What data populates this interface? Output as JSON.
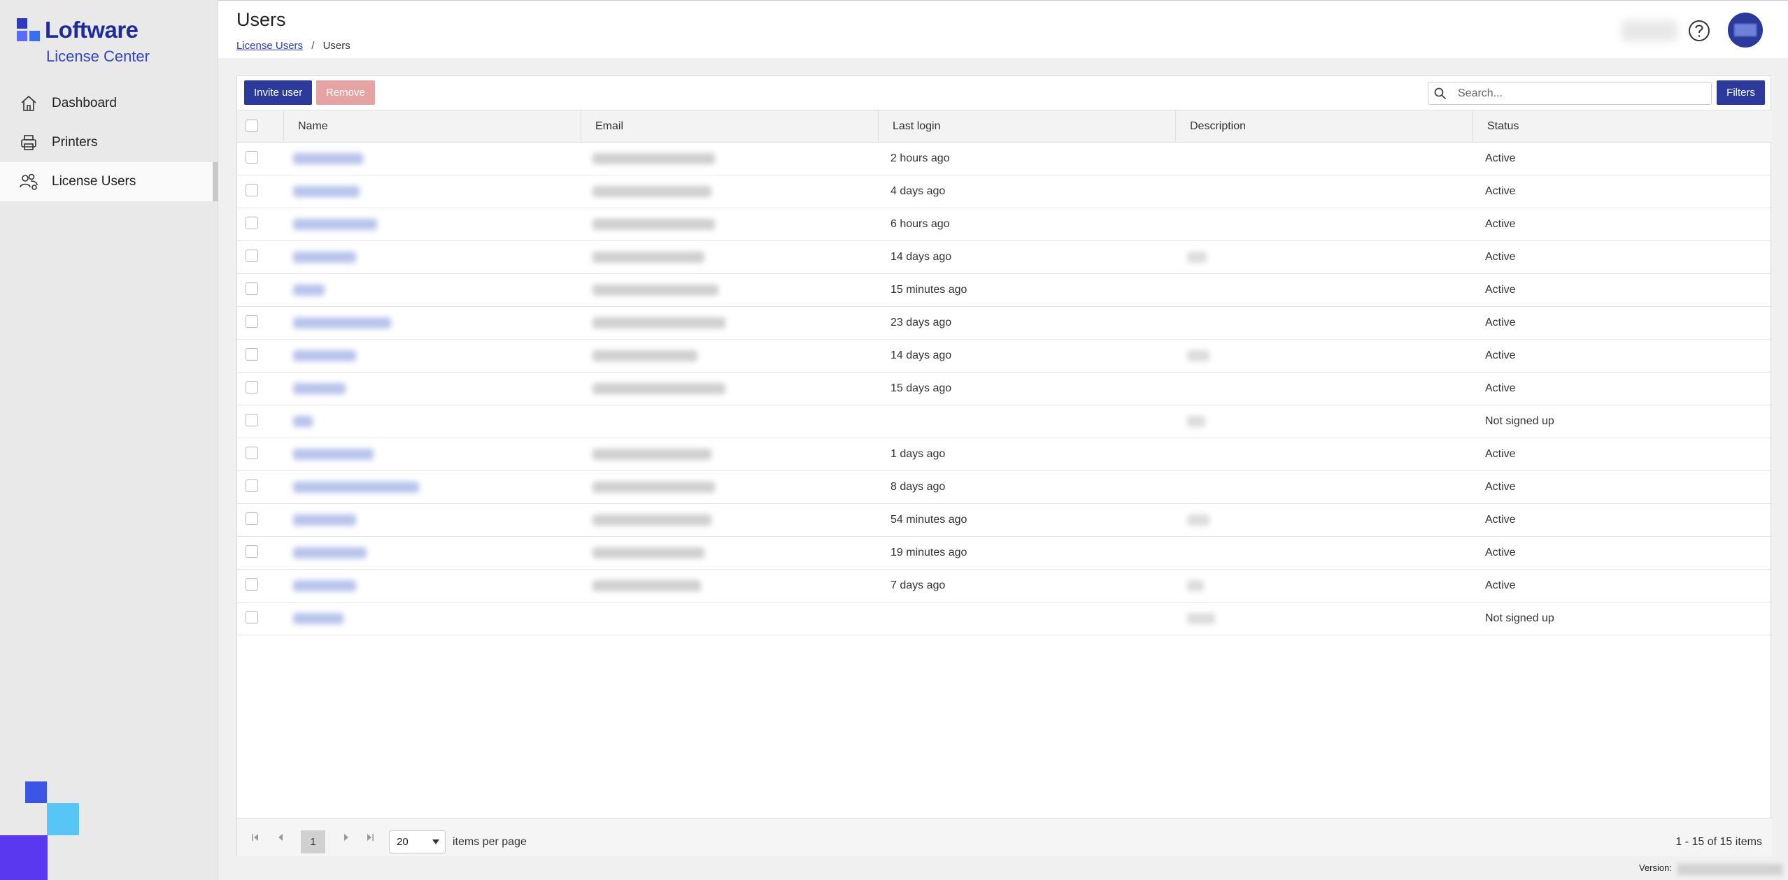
{
  "brand": {
    "name": "Loftware",
    "subtitle": "License Center"
  },
  "sidebar": {
    "items": [
      {
        "label": "Dashboard",
        "icon": "home-icon",
        "active": false
      },
      {
        "label": "Printers",
        "icon": "printer-icon",
        "active": false
      },
      {
        "label": "License Users",
        "icon": "users-icon",
        "active": true
      }
    ]
  },
  "header": {
    "title": "Users",
    "breadcrumb": {
      "parent": "License Users",
      "separator": "/",
      "current": "Users"
    }
  },
  "toolbar": {
    "invite_label": "Invite user",
    "remove_label": "Remove",
    "search_placeholder": "Search...",
    "filters_label": "Filters"
  },
  "table": {
    "columns": [
      "Name",
      "Email",
      "Last login",
      "Description",
      "Status"
    ],
    "rows": [
      {
        "last_login": "2 hours ago",
        "status": "Active"
      },
      {
        "last_login": "4 days ago",
        "status": "Active"
      },
      {
        "last_login": "6 hours ago",
        "status": "Active"
      },
      {
        "last_login": "14 days ago",
        "status": "Active"
      },
      {
        "last_login": "15 minutes ago",
        "status": "Active"
      },
      {
        "last_login": "23 days ago",
        "status": "Active"
      },
      {
        "last_login": "14 days ago",
        "status": "Active"
      },
      {
        "last_login": "15 days ago",
        "status": "Active"
      },
      {
        "last_login": "",
        "status": "Not signed up"
      },
      {
        "last_login": "1 days ago",
        "status": "Active"
      },
      {
        "last_login": "8 days ago",
        "status": "Active"
      },
      {
        "last_login": "54 minutes ago",
        "status": "Active"
      },
      {
        "last_login": "19 minutes ago",
        "status": "Active"
      },
      {
        "last_login": "7 days ago",
        "status": "Active"
      },
      {
        "last_login": "",
        "status": "Not signed up"
      }
    ]
  },
  "pagination": {
    "current_page": "1",
    "page_size": "20",
    "page_size_label": "items per page",
    "summary": "1 - 15 of 15 items"
  },
  "footer": {
    "version_label": "Version:"
  },
  "colors": {
    "brand": "#2c3a9b",
    "remove_disabled": "#e5a3a3",
    "sidebar_bg": "#e9e9e9"
  }
}
